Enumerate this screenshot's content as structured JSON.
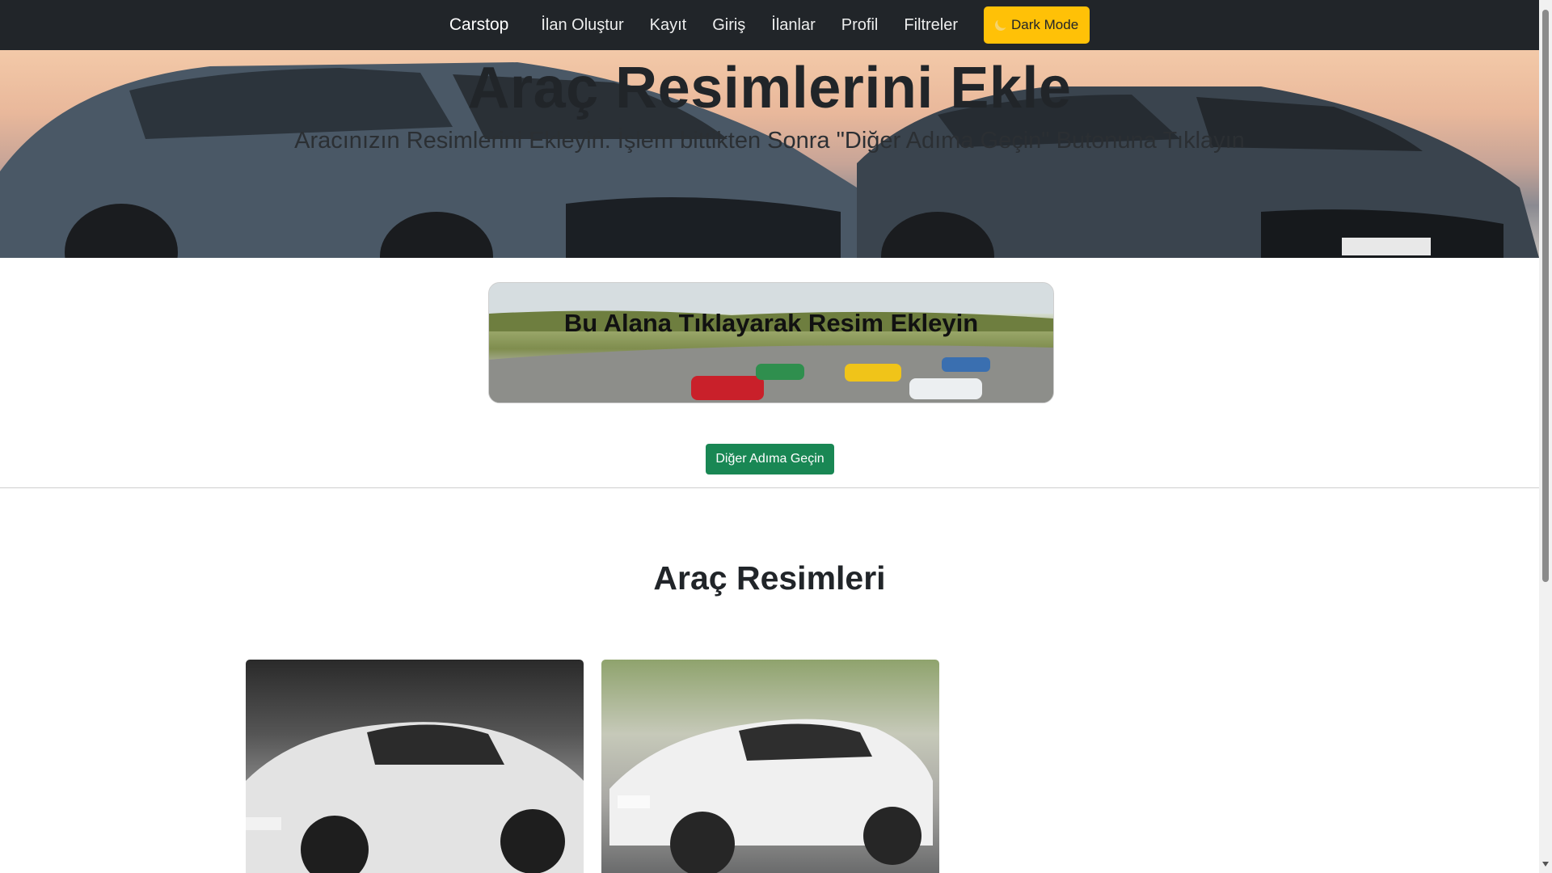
{
  "navbar": {
    "brand": "Carstop",
    "links": [
      "İlan Oluştur",
      "Kayıt",
      "Giriş",
      "İlanlar",
      "Profil",
      "Filtreler"
    ],
    "dark_mode_label": "Dark Mode",
    "dark_mode_icon": "moon-icon",
    "accent": "#ffc107"
  },
  "hero": {
    "title": "Araç Resimlerini Ekle",
    "subtitle": "Aracınızın Resimlerini Ekleyin. İşlem bittikten Sonra \"Diğer Adıma Geçin\" Butonuna Tıklayın"
  },
  "upload": {
    "label": "Bu Alana Tıklayarak Resim Ekleyin"
  },
  "next_button": {
    "label": "Diğer Adıma Geçin",
    "color": "#198754"
  },
  "gallery": {
    "title": "Araç Resimleri"
  }
}
